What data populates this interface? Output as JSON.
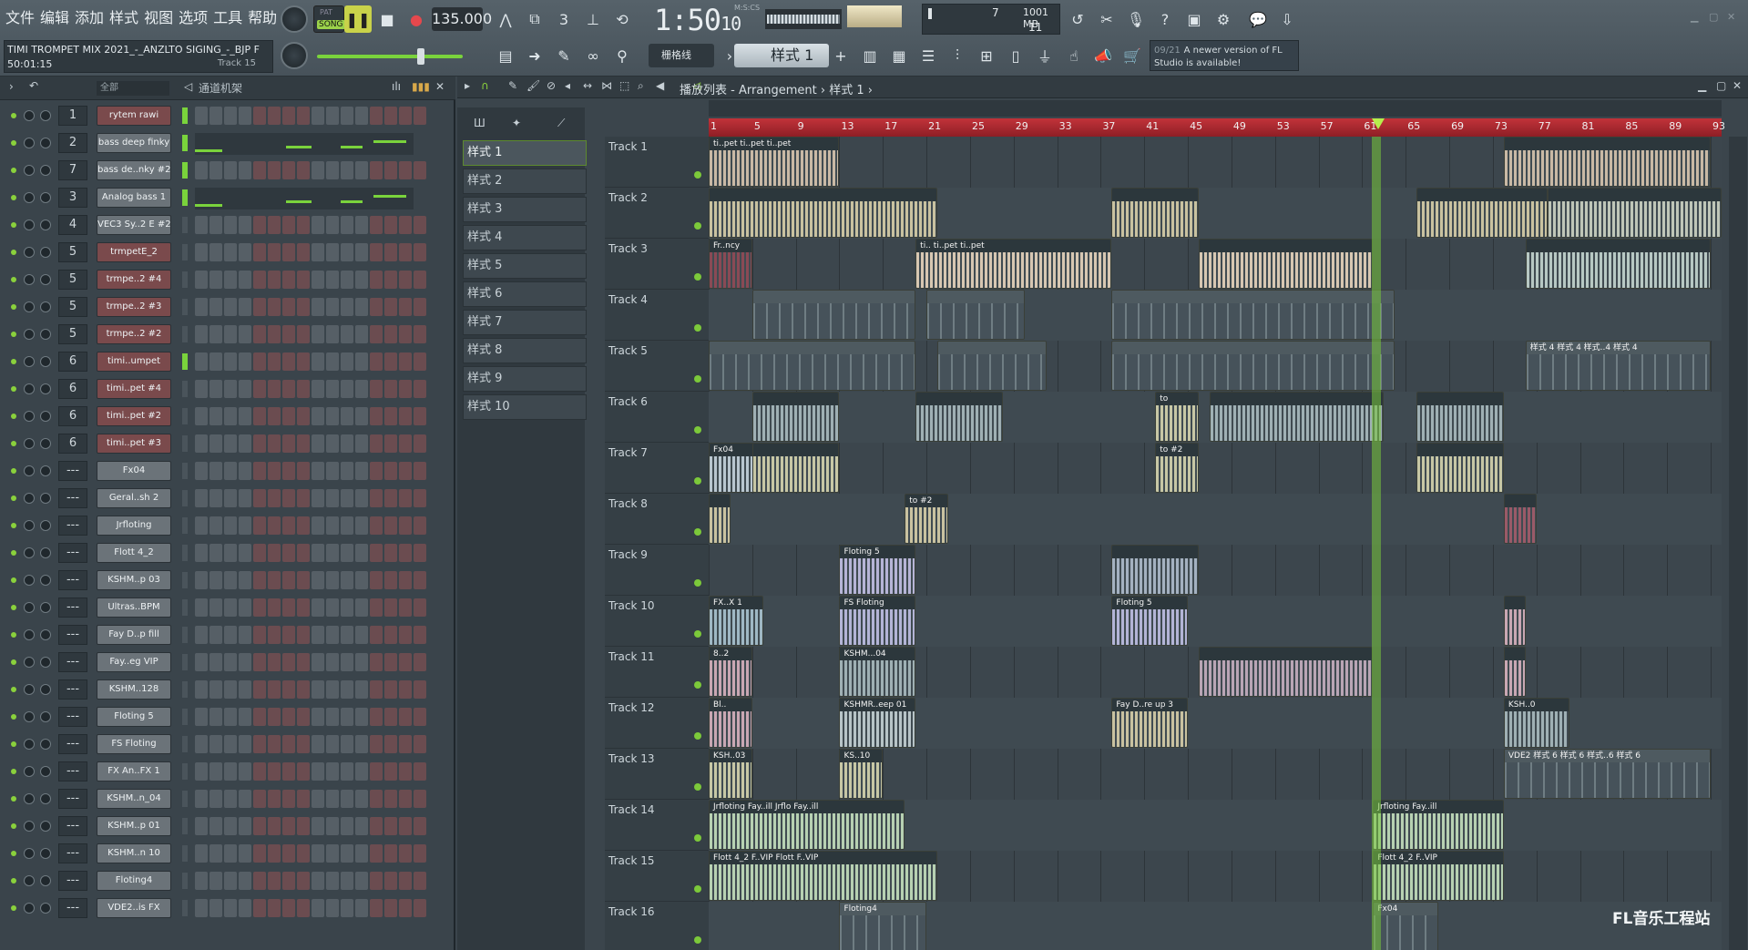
{
  "menu": [
    "文件",
    "编辑",
    "添加",
    "样式",
    "视图",
    "选项",
    "工具",
    "帮助"
  ],
  "project": {
    "title": "TIMI TROMPET MIX 2021_-_ANZLTO SIGING_-_BJP F",
    "time": "50:01:15",
    "hint": "Track 15"
  },
  "transport": {
    "pat_label": "PAT",
    "song_label": "SONG",
    "tempo": "135.000",
    "time": "1:50",
    "time_sub": "10",
    "time_unit": "M:S:CS",
    "cpu": "7",
    "memory": "1001 MB",
    "poly": "11"
  },
  "snap": "栅格线",
  "pattern_select": "样式 1",
  "news": {
    "date": "09/21",
    "text": "A newer version of FL Studio is available!"
  },
  "channel_rack": {
    "filter": "全部",
    "title": "通道机架",
    "channels": [
      {
        "num": "1",
        "name": "rytem rawi",
        "red": true,
        "mode": "steps"
      },
      {
        "num": "2",
        "name": "bass deep finky",
        "red": false,
        "mode": "roll"
      },
      {
        "num": "7",
        "name": "bass de..nky #2",
        "red": false,
        "mode": "steps"
      },
      {
        "num": "3",
        "name": "Analog bass 1",
        "red": false,
        "mode": "roll"
      },
      {
        "num": "4",
        "name": "VEC3 Sy..2 E #2",
        "red": false,
        "mode": "steps"
      },
      {
        "num": "5",
        "name": "trmpetE_2",
        "red": true,
        "mode": "steps"
      },
      {
        "num": "5",
        "name": "trmpe..2 #4",
        "red": true,
        "mode": "steps"
      },
      {
        "num": "5",
        "name": "trmpe..2 #3",
        "red": true,
        "mode": "steps"
      },
      {
        "num": "5",
        "name": "trmpe..2 #2",
        "red": true,
        "mode": "steps"
      },
      {
        "num": "6",
        "name": "timi..umpet",
        "red": true,
        "mode": "steps"
      },
      {
        "num": "6",
        "name": "timi..pet #4",
        "red": true,
        "mode": "steps"
      },
      {
        "num": "6",
        "name": "timi..pet #2",
        "red": true,
        "mode": "steps"
      },
      {
        "num": "6",
        "name": "timi..pet #3",
        "red": true,
        "mode": "steps"
      },
      {
        "num": "---",
        "name": "Fx04",
        "red": false,
        "mode": "steps"
      },
      {
        "num": "---",
        "name": "Geral..sh 2",
        "red": false,
        "mode": "steps"
      },
      {
        "num": "---",
        "name": "Jrfloting",
        "red": false,
        "mode": "steps"
      },
      {
        "num": "---",
        "name": "Flott 4_2",
        "red": false,
        "mode": "steps"
      },
      {
        "num": "---",
        "name": "KSHM..p 03",
        "red": false,
        "mode": "steps"
      },
      {
        "num": "---",
        "name": "Ultras..BPM",
        "red": false,
        "mode": "steps"
      },
      {
        "num": "---",
        "name": "Fay D..p fill",
        "red": false,
        "mode": "steps"
      },
      {
        "num": "---",
        "name": "Fay..eg VIP",
        "red": false,
        "mode": "steps"
      },
      {
        "num": "---",
        "name": "KSHM..128",
        "red": false,
        "mode": "steps"
      },
      {
        "num": "---",
        "name": "Floting 5",
        "red": false,
        "mode": "steps"
      },
      {
        "num": "---",
        "name": "FS Floting",
        "red": false,
        "mode": "steps"
      },
      {
        "num": "---",
        "name": "FX An..FX 1",
        "red": false,
        "mode": "steps"
      },
      {
        "num": "---",
        "name": "KSHM..n_04",
        "red": false,
        "mode": "steps"
      },
      {
        "num": "---",
        "name": "KSHM..p 01",
        "red": false,
        "mode": "steps"
      },
      {
        "num": "---",
        "name": "KSHM..n 10",
        "red": false,
        "mode": "steps"
      },
      {
        "num": "---",
        "name": "Floting4",
        "red": false,
        "mode": "steps"
      },
      {
        "num": "---",
        "name": "VDE2..is FX",
        "red": false,
        "mode": "steps"
      }
    ]
  },
  "patterns": [
    "样式 1",
    "样式 2",
    "样式 3",
    "样式 4",
    "样式 5",
    "样式 6",
    "样式 7",
    "样式 8",
    "样式 9",
    "样式 10"
  ],
  "playlist": {
    "title": "播放列表 - Arrangement › 样式 1 ›",
    "bars": [
      "1",
      "5",
      "9",
      "13",
      "17",
      "21",
      "25",
      "29",
      "33",
      "37",
      "41",
      "45",
      "49",
      "53",
      "57",
      "61",
      "65",
      "69",
      "73",
      "77",
      "81",
      "85",
      "89",
      "93"
    ],
    "tracks": [
      {
        "name": "Track 1",
        "clips": [
          {
            "b": 1,
            "len": 12,
            "label": "ti..pet  ti..pet  ti..pet",
            "color": "#c9b9a5"
          },
          {
            "b": 74,
            "len": 19,
            "label": "",
            "color": "#c9b9a5"
          }
        ]
      },
      {
        "name": "Track 2",
        "clips": [
          {
            "b": 1,
            "len": 21,
            "label": "",
            "color": "#c9c2a0"
          },
          {
            "b": 38,
            "len": 8,
            "label": "",
            "color": "#c9c2a0"
          },
          {
            "b": 66,
            "len": 12,
            "label": "",
            "color": "#c9c2a0"
          },
          {
            "b": 78,
            "len": 16,
            "label": "",
            "color": "#bfc6b8"
          }
        ]
      },
      {
        "name": "Track 3",
        "clips": [
          {
            "b": 1,
            "len": 4,
            "label": "Fr..ncy",
            "color": "#8a4a55"
          },
          {
            "b": 20,
            "len": 18,
            "label": "ti..  ti..pet   ti..pet",
            "color": "#d7c7b2"
          },
          {
            "b": 46,
            "len": 16,
            "label": "",
            "color": "#d7c7b2"
          },
          {
            "b": 76,
            "len": 17,
            "label": "",
            "color": "#b7c8c3"
          }
        ]
      },
      {
        "name": "Track 4",
        "clips": [
          {
            "b": 5,
            "len": 15,
            "label": "",
            "color": "#5d6a6f"
          },
          {
            "b": 21,
            "len": 9,
            "label": "",
            "color": "#5d6a6f"
          },
          {
            "b": 38,
            "len": 26,
            "label": "",
            "color": "#5d6a6f"
          }
        ]
      },
      {
        "name": "Track 5",
        "clips": [
          {
            "b": 1,
            "len": 19,
            "label": "",
            "color": "#5d6a6f"
          },
          {
            "b": 22,
            "len": 10,
            "label": "",
            "color": "#5d6a6f"
          },
          {
            "b": 38,
            "len": 26,
            "label": "",
            "color": "#5d6a6f"
          },
          {
            "b": 76,
            "len": 17,
            "label": "样式 4  样式 4  样式..4  样式 4",
            "color": "#5d6a6f"
          }
        ]
      },
      {
        "name": "Track 6",
        "clips": [
          {
            "b": 5,
            "len": 8,
            "label": "",
            "color": "#9fb0b4"
          },
          {
            "b": 20,
            "len": 8,
            "label": "",
            "color": "#9fb0b4"
          },
          {
            "b": 42,
            "len": 4,
            "label": "to",
            "color": "#c7c7a5"
          },
          {
            "b": 47,
            "len": 16,
            "label": "",
            "color": "#9fb0b4"
          },
          {
            "b": 66,
            "len": 8,
            "label": "",
            "color": "#9fb0b4"
          }
        ]
      },
      {
        "name": "Track 7",
        "clips": [
          {
            "b": 1,
            "len": 5,
            "label": "Fx04",
            "color": "#b8c6cf"
          },
          {
            "b": 5,
            "len": 8,
            "label": "",
            "color": "#c7c7a5"
          },
          {
            "b": 42,
            "len": 4,
            "label": "to #2",
            "color": "#c7c7a5"
          },
          {
            "b": 66,
            "len": 8,
            "label": "",
            "color": "#c7c7a5"
          }
        ]
      },
      {
        "name": "Track 8",
        "clips": [
          {
            "b": 1,
            "len": 2,
            "label": "",
            "color": "#c9c2a0"
          },
          {
            "b": 19,
            "len": 4,
            "label": "to #2",
            "color": "#c9c2a0"
          },
          {
            "b": 74,
            "len": 3,
            "label": "",
            "color": "#9a5a68"
          }
        ]
      },
      {
        "name": "Track 9",
        "clips": [
          {
            "b": 13,
            "len": 7,
            "label": "Floting 5",
            "color": "#b6b4d6"
          },
          {
            "b": 38,
            "len": 8,
            "label": "",
            "color": "#a4b1c0"
          }
        ]
      },
      {
        "name": "Track 10",
        "clips": [
          {
            "b": 1,
            "len": 5,
            "label": "FX..X 1",
            "color": "#9fb8c4"
          },
          {
            "b": 13,
            "len": 7,
            "label": "FS Floting",
            "color": "#b3b4d6"
          },
          {
            "b": 38,
            "len": 7,
            "label": "Floting 5",
            "color": "#b3b4d6"
          },
          {
            "b": 74,
            "len": 2,
            "label": "",
            "color": "#c9a7b3"
          }
        ]
      },
      {
        "name": "Track 11",
        "clips": [
          {
            "b": 1,
            "len": 4,
            "label": "8..2",
            "color": "#c9a7b3"
          },
          {
            "b": 13,
            "len": 7,
            "label": "KSHM...04",
            "color": "#9fb0b4"
          },
          {
            "b": 46,
            "len": 16,
            "label": "",
            "color": "#b9a5b5"
          },
          {
            "b": 74,
            "len": 2,
            "label": "",
            "color": "#c9a7b3"
          }
        ]
      },
      {
        "name": "Track 12",
        "clips": [
          {
            "b": 1,
            "len": 4,
            "label": "Bl..",
            "color": "#c9a7b3"
          },
          {
            "b": 13,
            "len": 7,
            "label": "KSHMR..eep 01",
            "color": "#b7c4c7"
          },
          {
            "b": 38,
            "len": 7,
            "label": "Fay D..re up 3",
            "color": "#c9c2a0"
          },
          {
            "b": 74,
            "len": 6,
            "label": "KSH..0",
            "color": "#9fb0b4"
          }
        ]
      },
      {
        "name": "Track 13",
        "clips": [
          {
            "b": 1,
            "len": 4,
            "label": "KSH..03",
            "color": "#c7c7a5"
          },
          {
            "b": 13,
            "len": 4,
            "label": "KS..10",
            "color": "#c7c7a5"
          },
          {
            "b": 74,
            "len": 19,
            "label": "VDE2 样式 6 样式 6 样式..6  样式 6",
            "color": "#5d6a6f"
          }
        ]
      },
      {
        "name": "Track 14",
        "clips": [
          {
            "b": 1,
            "len": 18,
            "label": "Jrfloting      Fay..ill  Jrflo Fay..ill",
            "color": "#b7d1b2"
          },
          {
            "b": 62,
            "len": 12,
            "label": "Jrfloting      Fay..ill",
            "color": "#b7d1b2"
          }
        ]
      },
      {
        "name": "Track 15",
        "clips": [
          {
            "b": 1,
            "len": 21,
            "label": "Flott 4_2   F..VIP  Flott F..VIP",
            "color": "#b7d1b2"
          },
          {
            "b": 62,
            "len": 12,
            "label": "Flott 4_2    F..VIP",
            "color": "#b7d1b2"
          }
        ]
      },
      {
        "name": "Track 16",
        "clips": [
          {
            "b": 13,
            "len": 8,
            "label": "Floting4",
            "color": "#5d6a6f"
          },
          {
            "b": 62,
            "len": 6,
            "label": "Fx04",
            "color": "#5d6a6f"
          }
        ]
      }
    ]
  },
  "watermark": "FL音乐工程站"
}
